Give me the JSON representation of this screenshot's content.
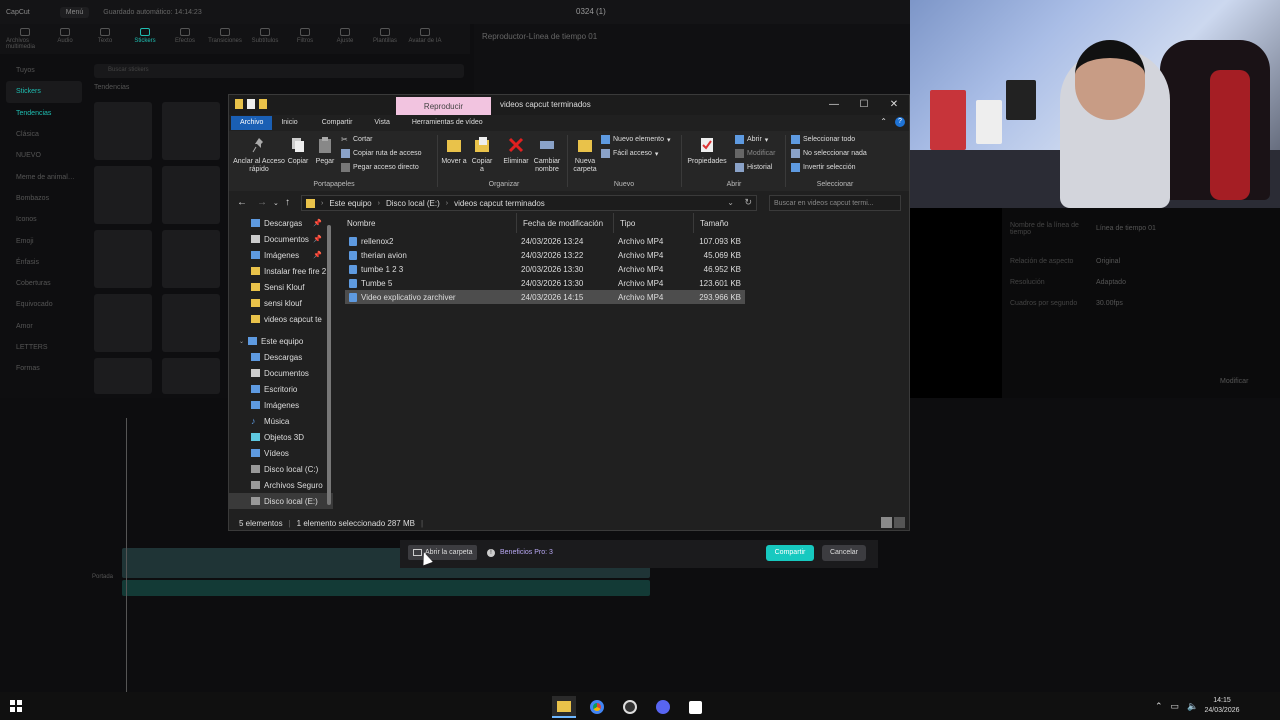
{
  "capcut": {
    "logo": "CapCut",
    "menu": "Menú",
    "autosave": "Guardado automático: 14:14:23",
    "project": "0324 (1)",
    "tools": [
      "Archivos multimedia",
      "Audio",
      "Texto",
      "Stickers",
      "Efectos",
      "Transiciones",
      "Subtítulos",
      "Filtros",
      "Ajuste",
      "Plantillas",
      "Avatar de IA"
    ],
    "sidebar": [
      "Tuyos",
      "Stickers",
      "Tendencias",
      "Clásica",
      "NUEVO",
      "Meme de animal…",
      "Bombazos",
      "Iconos",
      "Emoji",
      "Énfasis",
      "Coberturas",
      "Equivocado",
      "Amor",
      "LETTERS",
      "Formas"
    ],
    "search_placeholder": "Buscar stickers",
    "tendencias": "Tendencias",
    "player_title": "Reproductor-Línea de tiempo 01",
    "props": [
      {
        "k": "Nombre de la línea de tiempo",
        "v": "Línea de tiempo 01"
      },
      {
        "k": "Relación de aspecto",
        "v": "Original"
      },
      {
        "k": "Resolución",
        "v": "Adaptado"
      },
      {
        "k": "Cuadros por segundo",
        "v": "30.00fps"
      }
    ],
    "modify": "Modificar",
    "portada": "Portada"
  },
  "explorer": {
    "play_tab": "Reproducir",
    "title": "videos capcut terminados",
    "win_min": "—",
    "win_max": "☐",
    "win_close": "✕",
    "tabs": [
      "Archivo",
      "Inicio",
      "Compartir",
      "Vista",
      "Herramientas de vídeo"
    ],
    "ribbon": {
      "pin": "Anclar al Acceso rápido",
      "copy": "Copiar",
      "paste": "Pegar",
      "cut": "Cortar",
      "copy_path": "Copiar ruta de acceso",
      "paste_shortcut": "Pegar acceso directo",
      "move": "Mover a",
      "copy_to": "Copiar a",
      "delete": "Eliminar",
      "rename": "Cambiar nombre",
      "new_folder": "Nueva carpeta",
      "new_item": "Nuevo elemento",
      "easy_access": "Fácil acceso",
      "properties": "Propiedades",
      "open": "Abrir",
      "edit": "Modificar",
      "history": "Historial",
      "select_all": "Seleccionar todo",
      "select_none": "No seleccionar nada",
      "invert": "Invertir selección",
      "groups": [
        "Portapapeles",
        "Organizar",
        "Nuevo",
        "Abrir",
        "Seleccionar"
      ]
    },
    "breadcrumbs": [
      "Este equipo",
      "Disco local (E:)",
      "videos capcut terminados"
    ],
    "search_placeholder": "Buscar en videos capcut termi...",
    "nav": [
      {
        "label": "Descargas",
        "pin": true
      },
      {
        "label": "Documentos",
        "pin": true
      },
      {
        "label": "Imágenes",
        "pin": true
      },
      {
        "label": "Instalar free fire 2",
        "pin": false
      },
      {
        "label": "Sensi Klouf",
        "pin": false
      },
      {
        "label": "sensi klouf",
        "pin": false
      },
      {
        "label": "videos capcut te",
        "pin": false
      },
      {
        "label": "Este equipo",
        "pin": false
      },
      {
        "label": "Descargas",
        "pin": false
      },
      {
        "label": "Documentos",
        "pin": false
      },
      {
        "label": "Escritorio",
        "pin": false
      },
      {
        "label": "Imágenes",
        "pin": false
      },
      {
        "label": "Música",
        "pin": false
      },
      {
        "label": "Objetos 3D",
        "pin": false
      },
      {
        "label": "Vídeos",
        "pin": false
      },
      {
        "label": "Disco local (C:)",
        "pin": false
      },
      {
        "label": "Archivos Seguro",
        "pin": false
      },
      {
        "label": "Disco local (E:)",
        "pin": false
      }
    ],
    "columns": [
      "Nombre",
      "Fecha de modificación",
      "Tipo",
      "Tamaño"
    ],
    "files": [
      {
        "name": "rellenox2",
        "date": "24/03/2026 13:24",
        "type": "Archivo MP4",
        "size": "107.093 KB"
      },
      {
        "name": "therian avion",
        "date": "24/03/2026 13:22",
        "type": "Archivo MP4",
        "size": "45.069 KB"
      },
      {
        "name": "tumbe 1 2 3",
        "date": "20/03/2026 13:30",
        "type": "Archivo MP4",
        "size": "46.952 KB"
      },
      {
        "name": "Tumbe 5",
        "date": "24/03/2026 13:30",
        "type": "Archivo MP4",
        "size": "123.601 KB"
      },
      {
        "name": "Video explicativo zarchiver",
        "date": "24/03/2026 14:15",
        "type": "Archivo MP4",
        "size": "293.966 KB"
      }
    ],
    "status_count": "5 elementos",
    "status_selected": "1 elemento seleccionado  287 MB"
  },
  "export_bar": {
    "open_folder": "Abrir la carpeta",
    "pro": "Beneficios Pro: 3",
    "share": "Compartir",
    "cancel": "Cancelar"
  },
  "taskbar": {
    "time": "14:15",
    "date": "24/03/2026",
    "apps": [
      "file-explorer",
      "chrome",
      "obs",
      "discord",
      "capcut"
    ]
  },
  "colors": {
    "accent_teal": "#17c9c0",
    "file_tab": "#1a5fb4",
    "play_tab": "#f2c4e0"
  }
}
